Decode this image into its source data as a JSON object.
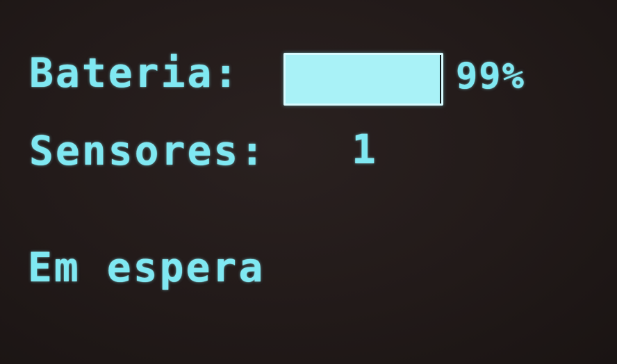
{
  "display": {
    "battery_label": "Bateria:",
    "battery_percent_text": "99%",
    "battery_level": 0.99,
    "sensors_label": "Sensores:",
    "sensors_value": "1",
    "status_text": "Em espera"
  },
  "colors": {
    "text": "#7fe8f2",
    "background": "#221a19",
    "bar_fill": "#a9f2f7"
  }
}
